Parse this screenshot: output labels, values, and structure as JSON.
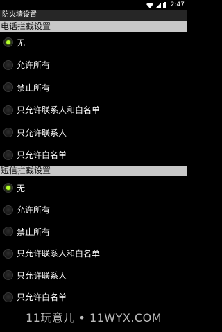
{
  "status_bar": {
    "time": "2:47"
  },
  "window": {
    "title": "防火墙设置"
  },
  "call_section": {
    "header": "电话拦截设置",
    "options": [
      {
        "label": "无",
        "checked": true
      },
      {
        "label": "允许所有",
        "checked": false
      },
      {
        "label": "禁止所有",
        "checked": false
      },
      {
        "label": "只允许联系人和白名单",
        "checked": false
      },
      {
        "label": "只允许联系人",
        "checked": false
      },
      {
        "label": "只允许白名单",
        "checked": false
      }
    ]
  },
  "sms_section": {
    "header": "短信拦截设置",
    "options": [
      {
        "label": "无",
        "checked": true
      },
      {
        "label": "允许所有",
        "checked": false
      },
      {
        "label": "禁止所有",
        "checked": false
      },
      {
        "label": "只允许联系人和白名单",
        "checked": false
      },
      {
        "label": "只允许联系人",
        "checked": false
      },
      {
        "label": "只允许白名单",
        "checked": false
      }
    ]
  },
  "watermark": "11玩意儿 • 11WYX.COM",
  "colors": {
    "accent": "#b6ff2a",
    "section_header_bg": "#c8c8c8",
    "title_bar_bg": "#262626"
  }
}
